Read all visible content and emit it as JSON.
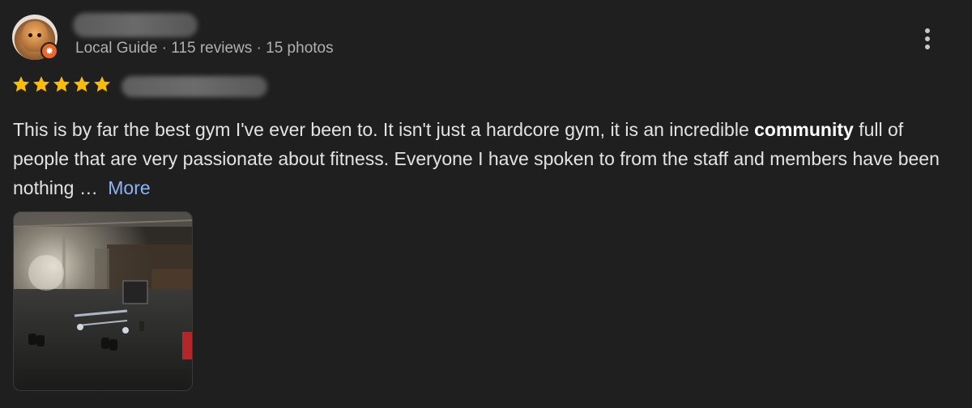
{
  "reviewer": {
    "meta": "Local Guide · 115 reviews · 15 photos",
    "avatar_icon": "dog-avatar",
    "badge_icon": "local-guide-star-badge"
  },
  "rating": {
    "stars": 5,
    "max": 5,
    "star_color": "#fbbc04"
  },
  "review": {
    "text_before": "This is by far the best gym I've ever been to. It isn't just a hardcore gym, it is an incredible ",
    "text_bold": "community",
    "text_after": " full of people that are very passionate about fitness. Everyone I have spoken to from the staff and members have been nothing … ",
    "more_label": "More"
  },
  "menu": {
    "icon": "more-vertical-icon"
  },
  "colors": {
    "background": "#1f1f1f",
    "text": "#e3e3e3",
    "meta_text": "#b0b0b0",
    "link": "#8ab4f8",
    "badge": "#e8672a"
  }
}
